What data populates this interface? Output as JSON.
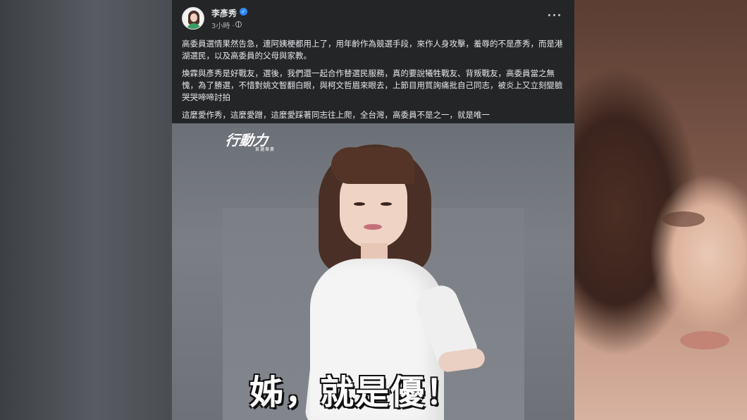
{
  "post": {
    "author": "李彥秀",
    "timestamp": "3小時 ·",
    "paragraphs": [
      "高委員選情果然告急，連阿姨梗都用上了，用年齡作為競選手段，來作人身攻擊，羞辱的不是彥秀，而是港湖選民，以及高委員的父母與家教。",
      "煥霖與彥秀是好戰友，選後，我們還一起合作替選民服務，真的要說犧牲戰友、背叛戰友，高委員當之無愧，為了勝選，不惜對姚文智翻白眼，與柯文哲眉來眼去，上節目用質詢痛批自己同志，被炎上又立刻變臉哭哭啼啼討拍",
      "這麼愛作秀，這麼愛蹭，這麼愛踩著同志往上爬，全台灣，高委員不是之一，就是唯一"
    ]
  },
  "photo": {
    "logo": "行動力",
    "logo_sub": "首選專業",
    "headline": "姊，就是優！"
  },
  "icons": {
    "verified": "verified-badge-icon",
    "privacy": "globe-icon",
    "more": "more-options-icon"
  },
  "colors": {
    "post_bg": "#242526",
    "text": "#e4e6eb",
    "muted": "#b0b3b8",
    "verified": "#2d88ff"
  }
}
